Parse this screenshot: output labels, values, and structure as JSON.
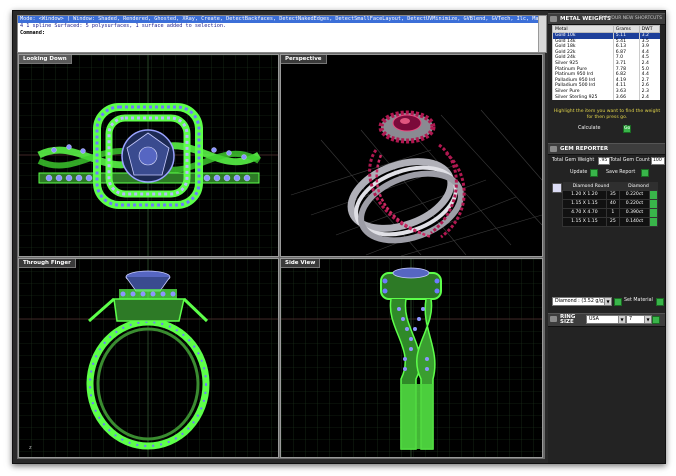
{
  "command_area": {
    "lines": [
      "Mode: <Window> ( Window: Shaded, Rendered, Ghosted, XRay, Create, DetectBackfaces, DetectNakedEdges, DetectSmallFaceLayout, DetectUVMinimize, GVBlend, GVTech, Ilc, Machine, Plastic, Presentation)",
      "4 1 spline Surfaced: 5 polysurfaces, 1 surface added to selection."
    ],
    "prompt": "Command:"
  },
  "viewports": {
    "top_left": "Looking Down",
    "top_right": "Perspective",
    "bottom_left": "Through Finger",
    "bottom_right": "Side View"
  },
  "metal_weights": {
    "header": "METAL WEIGHTS",
    "subheader": "TAP YOUR NEW SHORTCUTS",
    "columns": [
      "Metal",
      "Grams",
      "DWT"
    ],
    "rows": [
      [
        "Gold 10k",
        "5.11",
        "3.2"
      ],
      [
        "Gold 14k",
        "5.41",
        "3.5"
      ],
      [
        "Gold 18k",
        "6.13",
        "3.9"
      ],
      [
        "Gold 22k",
        "6.87",
        "4.4"
      ],
      [
        "Gold 24k",
        "7.0",
        "4.5"
      ],
      [
        "Silver 925",
        "3.71",
        "2.4"
      ],
      [
        "Platinum Pure",
        "7.78",
        "5.0"
      ],
      [
        "Platinum 950 Ird",
        "6.82",
        "4.4"
      ],
      [
        "Palladium 950 Ird",
        "4.19",
        "2.7"
      ],
      [
        "Palladium 500 Ird",
        "4.11",
        "2.6"
      ],
      [
        "Silver Pure",
        "3.63",
        "2.3"
      ],
      [
        "Silver Sterling 925",
        "3.66",
        "2.4"
      ]
    ],
    "highlight_note": "Highlight the item you want to find the weight for then press go.",
    "calculate_label": "Calculate",
    "go_label": "Go"
  },
  "gem_reporter": {
    "header": "GEM REPORTER",
    "total_gem_weight_label": "Total Gem Weight",
    "total_gem_weight_value": ".95",
    "total_gem_count_label": "Total Gem Count",
    "total_gem_count_value": "100",
    "update_label": "Update",
    "save_report_label": "Save Report",
    "table_headers": [
      "Diamond Round",
      "Diamond"
    ],
    "rows": [
      [
        "1.20 X 1.20",
        "35",
        "0.220ct"
      ],
      [
        "1.15 X 1.15",
        "40",
        "0.220ct"
      ],
      [
        "4.70 X 4.70",
        "1",
        "0.390ct"
      ],
      [
        "1.15 X 1.15",
        "25",
        "0.140ct"
      ]
    ]
  },
  "material": {
    "selected": "Diamond : (3.52 g/g)",
    "set_material_label": "Set Material"
  },
  "ring_size": {
    "label": "RING SIZE",
    "region": "USA",
    "size": "7"
  },
  "colors": {
    "wireframe_green": "#5dff4a",
    "gem_blue": "#6f7bff",
    "ruby": "#b01850",
    "metal_silver": "#d8d8dc",
    "panel_bg": "#232323"
  }
}
